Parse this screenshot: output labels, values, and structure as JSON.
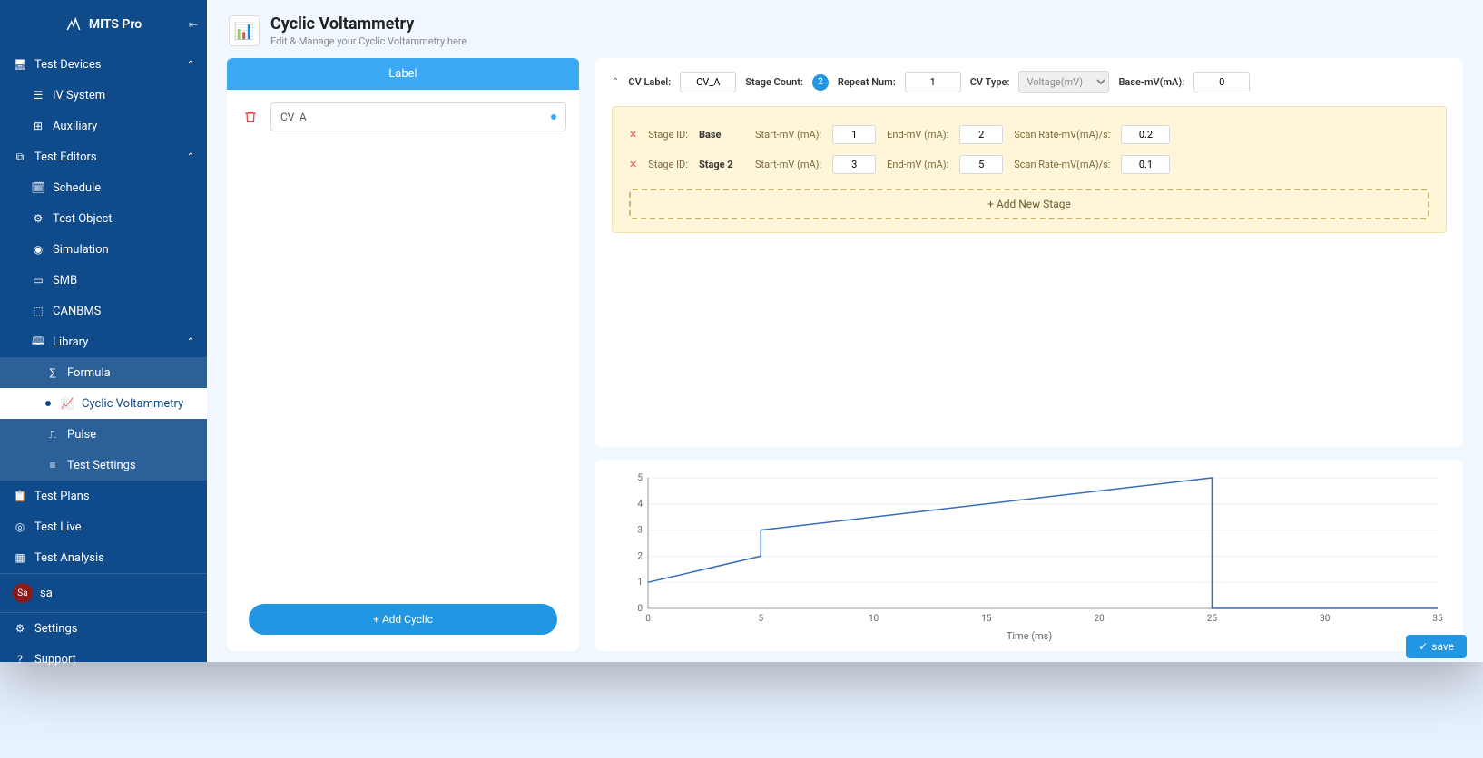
{
  "app_name": "MITS Pro",
  "sidebar": {
    "sections": {
      "test_devices": {
        "label": "Test Devices",
        "items": [
          {
            "label": "IV System"
          },
          {
            "label": "Auxiliary"
          }
        ]
      },
      "test_editors": {
        "label": "Test Editors",
        "items": [
          {
            "label": "Schedule"
          },
          {
            "label": "Test Object"
          },
          {
            "label": "Simulation"
          },
          {
            "label": "SMB"
          },
          {
            "label": "CANBMS"
          },
          {
            "label": "Library",
            "children": [
              {
                "label": "Formula"
              },
              {
                "label": "Cyclic Voltammetry"
              },
              {
                "label": "Pulse"
              },
              {
                "label": "Test Settings"
              }
            ]
          }
        ]
      },
      "test_plans": {
        "label": "Test Plans"
      },
      "test_live": {
        "label": "Test Live"
      },
      "test_analysis": {
        "label": "Test Analysis"
      }
    },
    "user": {
      "avatar": "Sa",
      "name": "sa"
    },
    "settings": "Settings",
    "support": "Support"
  },
  "page": {
    "title": "Cyclic Voltammetry",
    "subtitle": "Edit & Manage your Cyclic Voltammetry here"
  },
  "left_panel": {
    "header": "Label",
    "items": [
      {
        "name": "CV_A"
      }
    ],
    "add_button": "+ Add Cyclic"
  },
  "config": {
    "cv_label_label": "CV Label:",
    "cv_label_value": "CV_A",
    "stage_count_label": "Stage Count:",
    "stage_count_value": "2",
    "repeat_num_label": "Repeat Num:",
    "repeat_num_value": "1",
    "cv_type_label": "CV Type:",
    "cv_type_value": "Voltage(mV)",
    "base_label": "Base-mV(mA):",
    "base_value": "0",
    "stages": [
      {
        "id_label": "Stage ID:",
        "id": "Base",
        "start_label": "Start-mV (mA):",
        "start": "1",
        "end_label": "End-mV (mA):",
        "end": "2",
        "rate_label": "Scan Rate-mV(mA)/s:",
        "rate": "0.2"
      },
      {
        "id_label": "Stage ID:",
        "id": "Stage 2",
        "start_label": "Start-mV (mA):",
        "start": "3",
        "end_label": "End-mV (mA):",
        "end": "5",
        "rate_label": "Scan Rate-mV(mA)/s:",
        "rate": "0.1"
      }
    ],
    "add_stage": "+ Add New Stage"
  },
  "chart_data": {
    "type": "line",
    "x": [
      0,
      5,
      5,
      25,
      25,
      35
    ],
    "y": [
      1,
      2,
      3,
      5,
      0,
      0
    ],
    "xlabel": "Time (ms)",
    "ylabel": "",
    "xlim": [
      0,
      35
    ],
    "ylim": [
      0,
      5
    ],
    "xticks": [
      0,
      5,
      10,
      15,
      20,
      25,
      30,
      35
    ],
    "yticks": [
      0,
      1,
      2,
      3,
      4,
      5
    ]
  },
  "save_button": "save"
}
